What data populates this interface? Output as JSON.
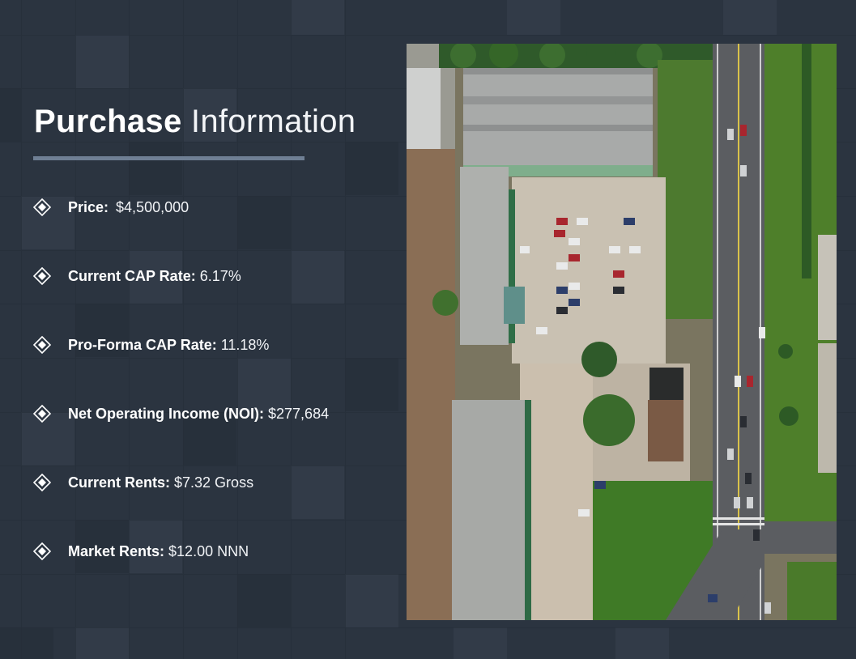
{
  "title": {
    "bold": "Purchase",
    "light": "Information"
  },
  "items": [
    {
      "label": "Price:",
      "value": "$4,500,000"
    },
    {
      "label": "Current CAP Rate:",
      "value": "6.17%"
    },
    {
      "label": "Pro-Forma CAP Rate:",
      "value": "11.18%"
    },
    {
      "label": "Net Operating Income (NOI):",
      "value": "$277,684"
    },
    {
      "label": "Current Rents:",
      "value": "$7.32 Gross"
    },
    {
      "label": "Market Rents:",
      "value": "$12.00 NNN"
    }
  ],
  "icons": {
    "bullet": "diamond-bullet-icon"
  },
  "colors": {
    "background": "#2b3440",
    "rule": "#6f7f94",
    "text": "#ffffff"
  }
}
